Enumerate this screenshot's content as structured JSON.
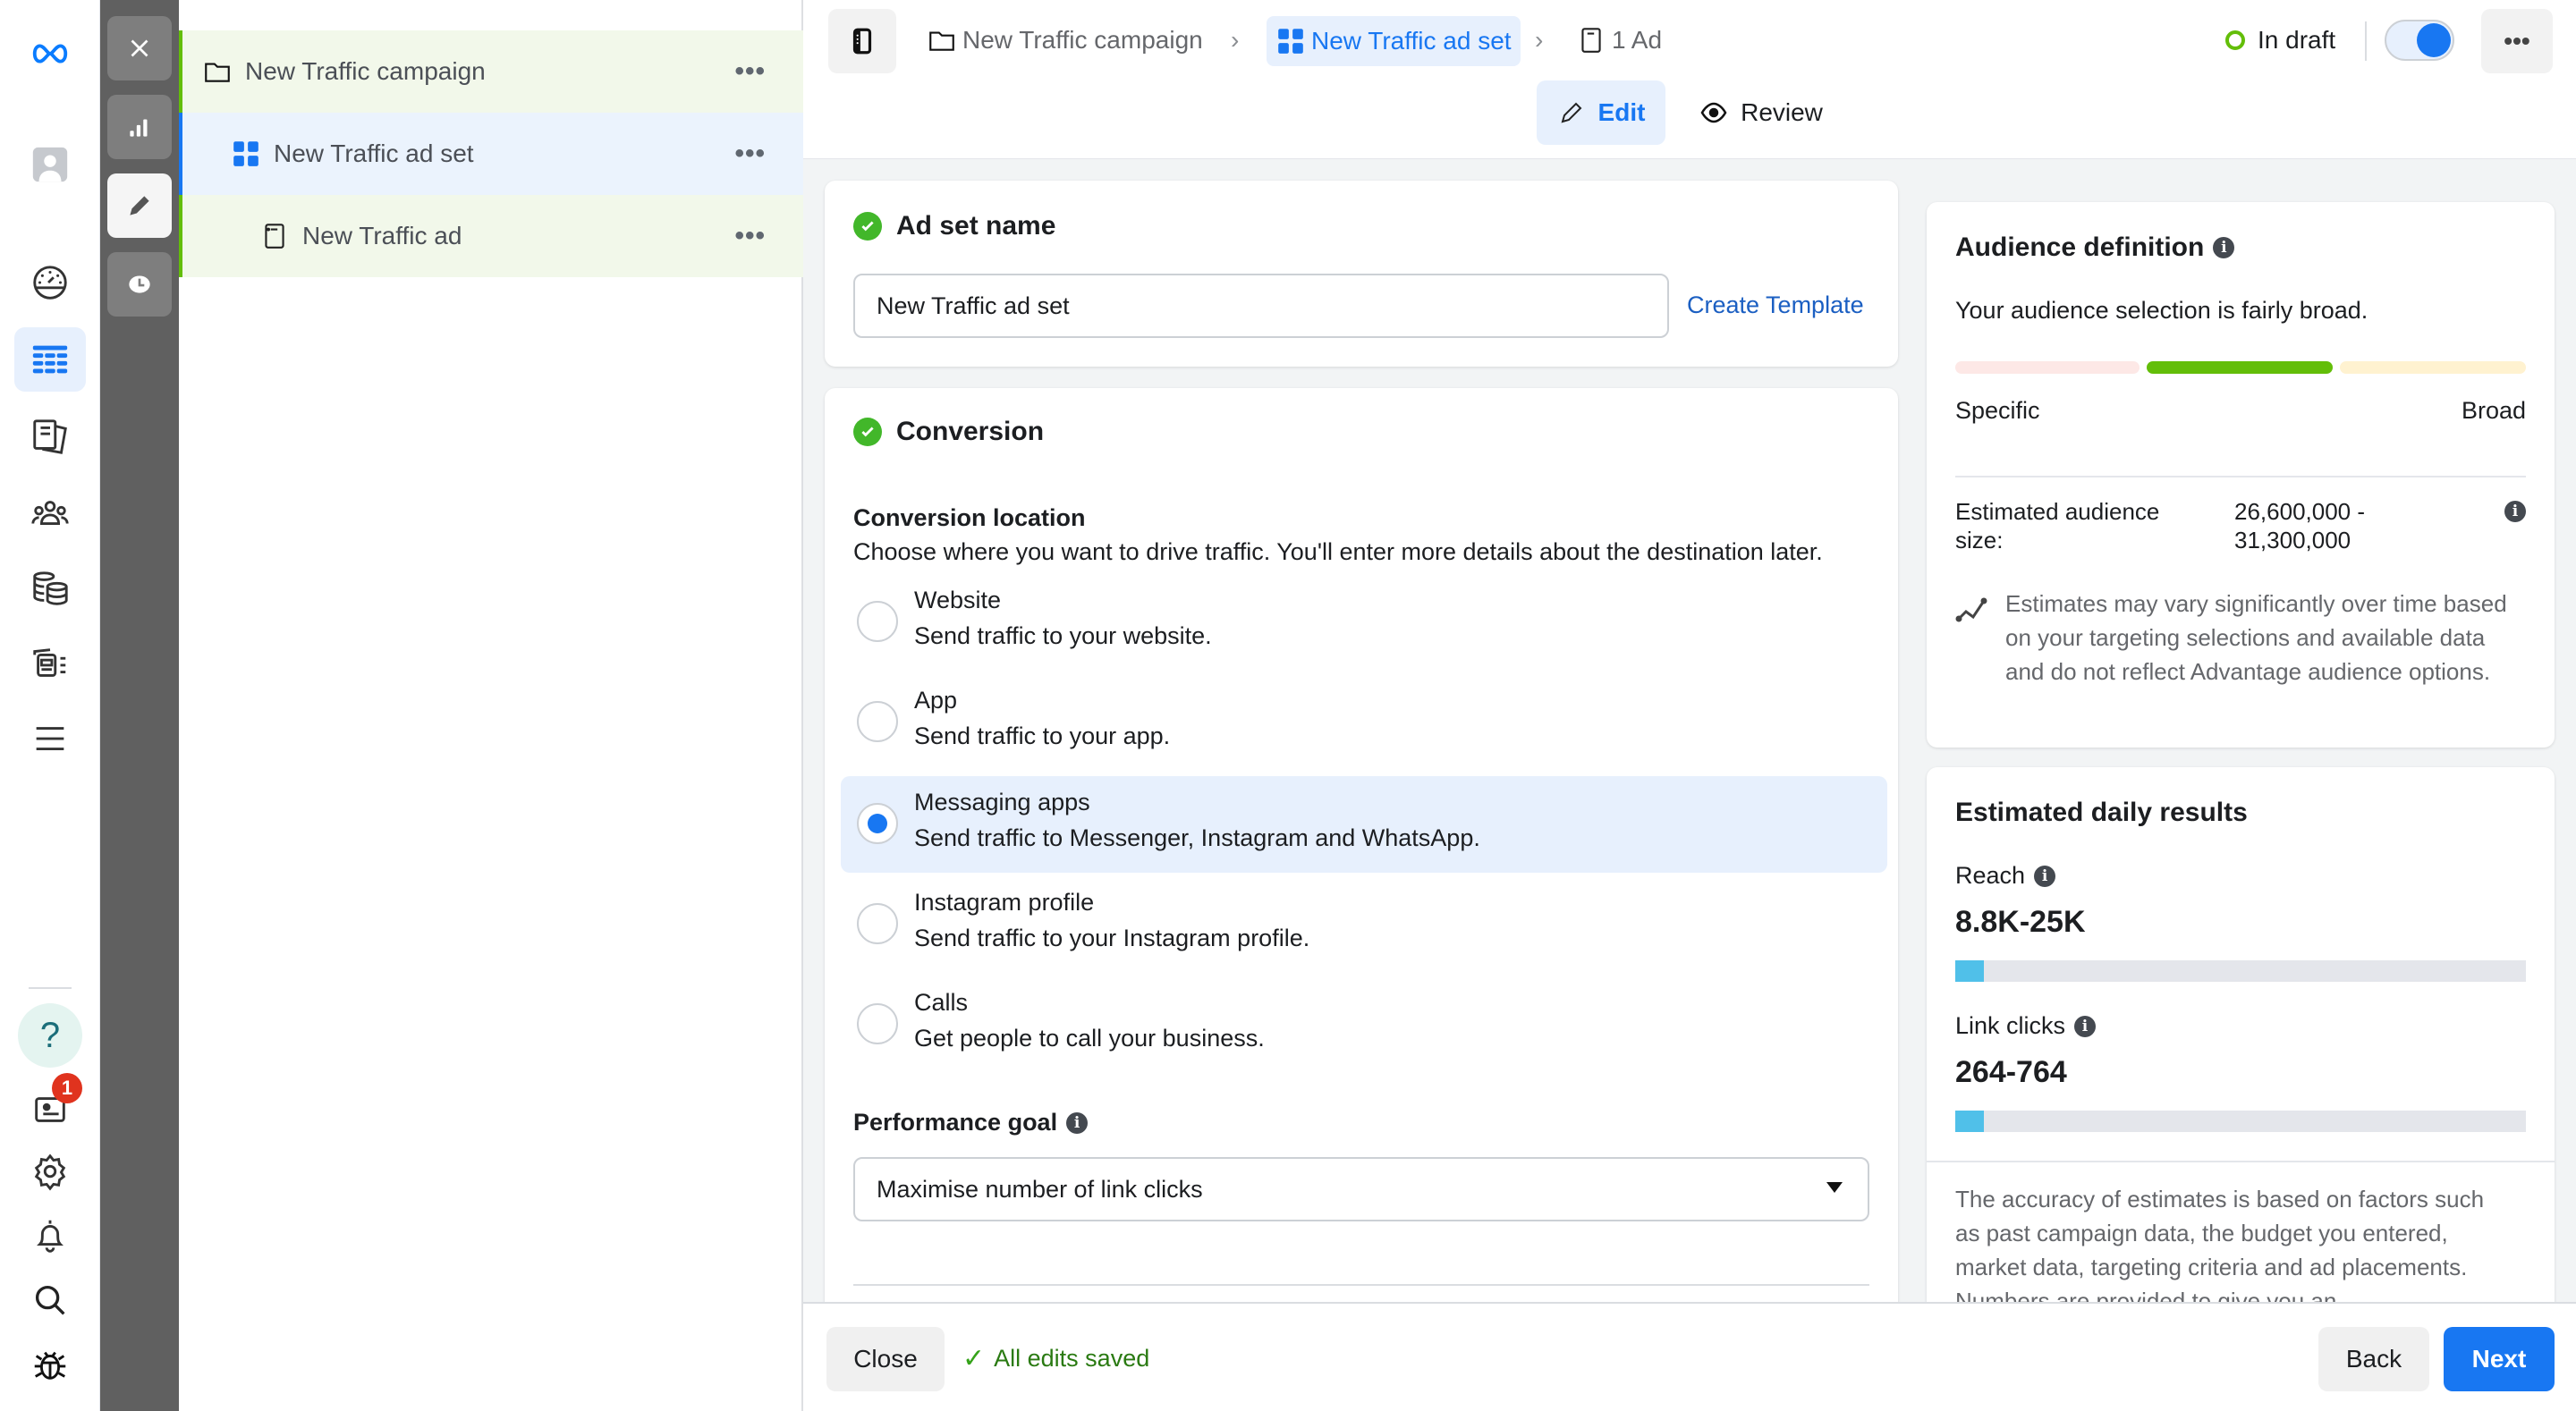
{
  "app": {
    "brand_icon": "meta-logo-icon"
  },
  "rail": {
    "items": [
      {
        "name": "avatar",
        "icon": "profile-avatar-icon"
      },
      {
        "name": "overview",
        "icon": "speedometer-icon"
      },
      {
        "name": "campaigns",
        "icon": "table-grid-icon",
        "active": true
      },
      {
        "name": "ads-reporting",
        "icon": "documents-icon"
      },
      {
        "name": "audiences",
        "icon": "people-icon"
      },
      {
        "name": "billing",
        "icon": "coins-icon"
      },
      {
        "name": "catalog",
        "icon": "media-list-icon"
      },
      {
        "name": "all-tools",
        "icon": "hamburger-menu-icon"
      }
    ],
    "bottom": [
      {
        "name": "help",
        "icon": "question-icon"
      },
      {
        "name": "news",
        "icon": "newspaper-icon",
        "badge": "1"
      },
      {
        "name": "settings",
        "icon": "gear-icon"
      },
      {
        "name": "notifications",
        "icon": "bell-icon"
      },
      {
        "name": "search",
        "icon": "search-icon"
      },
      {
        "name": "report-bug",
        "icon": "bug-icon"
      }
    ]
  },
  "tools": [
    "close-icon",
    "bar-chart-icon",
    "pencil-icon",
    "clock-icon"
  ],
  "tree": {
    "items": [
      {
        "label": "New Traffic campaign",
        "icon": "folder-icon",
        "more": "•••"
      },
      {
        "label": "New Traffic ad set",
        "icon": "grid-icon",
        "more": "•••"
      },
      {
        "label": "New Traffic ad",
        "icon": "ad-icon",
        "more": "•••"
      }
    ]
  },
  "breadcrumb": {
    "campaign": "New Traffic campaign",
    "adset": "New Traffic ad set",
    "ads": "1 Ad"
  },
  "status": {
    "label": "In draft",
    "toggle_on": true,
    "more": "•••"
  },
  "mode_tabs": {
    "edit": "Edit",
    "review": "Review"
  },
  "adset_name": {
    "title": "Ad set name",
    "value": "New Traffic ad set",
    "create_template": "Create Template"
  },
  "conversion": {
    "title": "Conversion",
    "location_label": "Conversion location",
    "location_help": "Choose where you want to drive traffic. You'll enter more details about the destination later.",
    "options": [
      {
        "title": "Website",
        "desc": "Send traffic to your website.",
        "selected": false
      },
      {
        "title": "App",
        "desc": "Send traffic to your app.",
        "selected": false
      },
      {
        "title": "Messaging apps",
        "desc": "Send traffic to Messenger, Instagram and WhatsApp.",
        "selected": true
      },
      {
        "title": "Instagram profile",
        "desc": "Send traffic to your Instagram profile.",
        "selected": false
      },
      {
        "title": "Calls",
        "desc": "Get people to call your business.",
        "selected": false
      }
    ],
    "performance_goal_label": "Performance goal",
    "performance_goal_value": "Maximise number of link clicks"
  },
  "audience": {
    "title": "Audience definition",
    "summary": "Your audience selection is fairly broad.",
    "meter_level": "middle-of-3",
    "specific": "Specific",
    "broad": "Broad",
    "size_label": "Estimated audience size:",
    "size_value_line1": "26,600,000 -",
    "size_value_line2": "31,300,000",
    "note": "Estimates may vary significantly over time based on your targeting selections and available data and do not reflect Advantage audience options."
  },
  "daily_results": {
    "title": "Estimated daily results",
    "reach_label": "Reach",
    "reach_value": "8.8K-25K",
    "reach_fill_pct": 5,
    "clicks_label": "Link clicks",
    "clicks_value": "264-764",
    "clicks_fill_pct": 5,
    "accuracy_note": "The accuracy of estimates is based on factors such as past campaign data, the budget you entered, market data, targeting criteria and ad placements. Numbers are provided to give you an"
  },
  "footer": {
    "close": "Close",
    "saved": "All edits saved",
    "back": "Back",
    "next": "Next"
  },
  "colors": {
    "accent": "#1877f2",
    "success": "#42b72a",
    "meter_green": "#63be09"
  }
}
